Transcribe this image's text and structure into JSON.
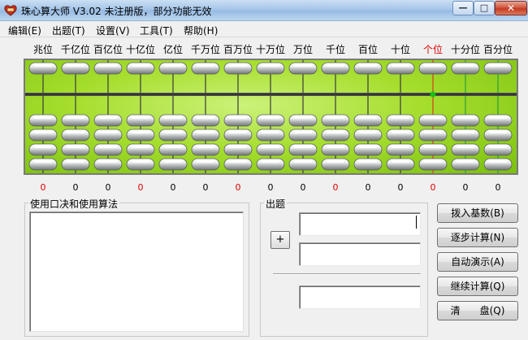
{
  "window": {
    "title": "珠心算大师 V3.02 未注册版，部分功能无效",
    "icon": "abacus-app-icon",
    "controls": {
      "minimize": "—",
      "maximize": "□",
      "close": "✕"
    }
  },
  "menu": [
    {
      "label": "编辑(E)"
    },
    {
      "label": "出题(T)"
    },
    {
      "label": "设置(V)"
    },
    {
      "label": "工具(T)"
    },
    {
      "label": "帮助(H)"
    }
  ],
  "columns": [
    {
      "label": "兆位",
      "value": "0",
      "highlight": true
    },
    {
      "label": "千亿位",
      "value": "0",
      "highlight": false
    },
    {
      "label": "百亿位",
      "value": "0",
      "highlight": false
    },
    {
      "label": "十亿位",
      "value": "0",
      "highlight": true
    },
    {
      "label": "亿位",
      "value": "0",
      "highlight": false
    },
    {
      "label": "千万位",
      "value": "0",
      "highlight": false
    },
    {
      "label": "百万位",
      "value": "0",
      "highlight": true
    },
    {
      "label": "十万位",
      "value": "0",
      "highlight": false
    },
    {
      "label": "万位",
      "value": "0",
      "highlight": false
    },
    {
      "label": "千位",
      "value": "0",
      "highlight": true
    },
    {
      "label": "百位",
      "value": "0",
      "highlight": false
    },
    {
      "label": "十位",
      "value": "0",
      "highlight": false
    },
    {
      "label": "个位",
      "value": "0",
      "highlight": true,
      "unit_column": true
    },
    {
      "label": "十分位",
      "value": "0",
      "highlight": false
    },
    {
      "label": "百分位",
      "value": "0",
      "highlight": false
    }
  ],
  "colors": {
    "accent_red": "#e00000",
    "abacus_green": "#a6de2e",
    "unit_rod": "#d83b1a",
    "decimal_rod": "#2a9d3a",
    "beam_dot": "#18c018"
  },
  "formula_panel": {
    "legend": "使用口决和使用算法",
    "content": ""
  },
  "question_panel": {
    "legend": "出题",
    "operator": "+",
    "operand1": "",
    "operand2": "",
    "result": ""
  },
  "buttons": {
    "dial_base": "拨入基数(B)",
    "step_calc": "逐步计算(N)",
    "auto_demo": "自动演示(A)",
    "continue_calc": "继续计算(Q)",
    "clear": "清　　盘(Q)"
  }
}
